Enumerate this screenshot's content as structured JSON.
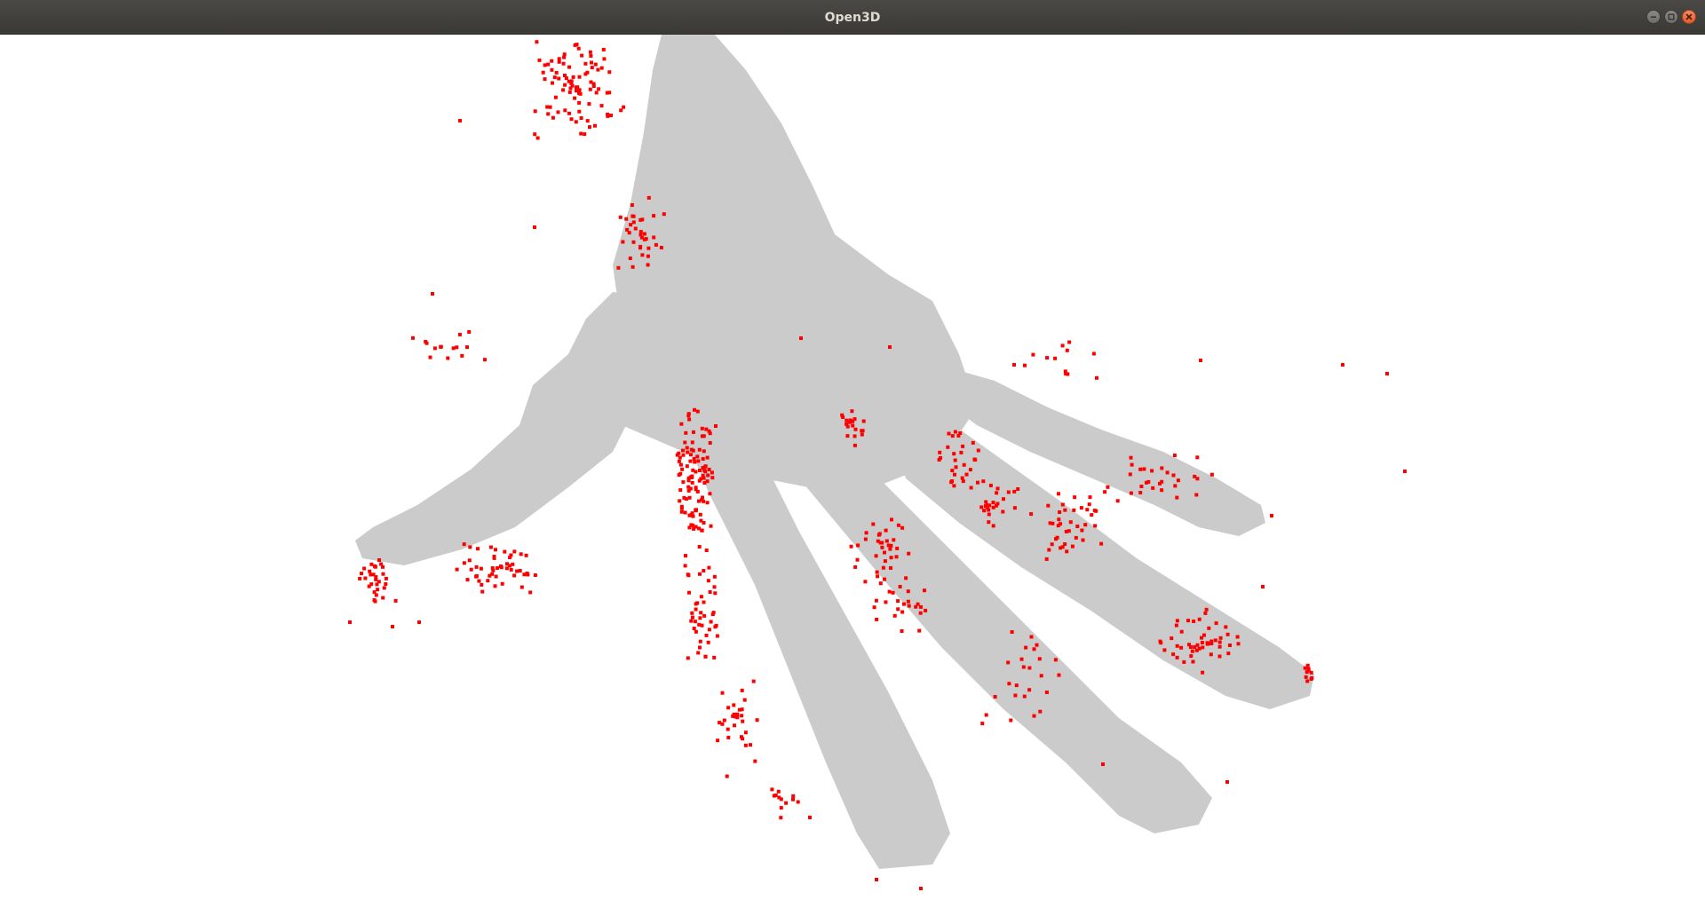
{
  "window": {
    "title": "Open3D"
  },
  "controls": {
    "minimize_icon": "minimize-icon",
    "maximize_icon": "maximize-icon",
    "close_icon": "close-icon"
  },
  "scene": {
    "background_color": "#ffffff",
    "point_cloud_color": "#cbcbcb",
    "highlight_point_color": "#ff0000"
  }
}
